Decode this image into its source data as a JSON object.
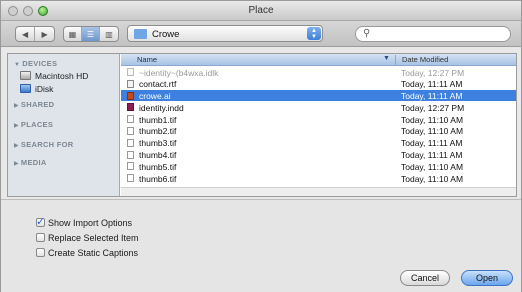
{
  "window": {
    "title": "Place"
  },
  "toolbar": {
    "path": "Crowe",
    "search_placeholder": ""
  },
  "sidebar": {
    "sections": [
      {
        "label": "DEVICES",
        "expanded": true,
        "items": [
          {
            "label": "Macintosh HD",
            "icon": "hard-drive-icon"
          },
          {
            "label": "iDisk",
            "icon": "idisk-icon"
          }
        ]
      },
      {
        "label": "SHARED",
        "expanded": false,
        "items": []
      },
      {
        "label": "PLACES",
        "expanded": false,
        "items": []
      },
      {
        "label": "SEARCH FOR",
        "expanded": false,
        "items": []
      },
      {
        "label": "MEDIA",
        "expanded": false,
        "items": []
      }
    ]
  },
  "list": {
    "columns": {
      "name": "Name",
      "date": "Date Modified"
    },
    "rows": [
      {
        "name": "~identity~(b4wxa.idlk",
        "date": "Today, 12:27 PM",
        "type": "idlk",
        "dimmed": true,
        "selected": false
      },
      {
        "name": "contact.rtf",
        "date": "Today, 11:11 AM",
        "type": "rtf",
        "dimmed": false,
        "selected": false
      },
      {
        "name": "crowe.ai",
        "date": "Today, 11:11 AM",
        "type": "ai",
        "dimmed": false,
        "selected": true
      },
      {
        "name": "identity.indd",
        "date": "Today, 12:27 PM",
        "type": "indd",
        "dimmed": false,
        "selected": false
      },
      {
        "name": "thumb1.tif",
        "date": "Today, 11:10 AM",
        "type": "tif",
        "dimmed": false,
        "selected": false
      },
      {
        "name": "thumb2.tif",
        "date": "Today, 11:10 AM",
        "type": "tif",
        "dimmed": false,
        "selected": false
      },
      {
        "name": "thumb3.tif",
        "date": "Today, 11:11 AM",
        "type": "tif",
        "dimmed": false,
        "selected": false
      },
      {
        "name": "thumb4.tif",
        "date": "Today, 11:11 AM",
        "type": "tif",
        "dimmed": false,
        "selected": false
      },
      {
        "name": "thumb5.tif",
        "date": "Today, 11:10 AM",
        "type": "tif",
        "dimmed": false,
        "selected": false
      },
      {
        "name": "thumb6.tif",
        "date": "Today, 11:10 AM",
        "type": "tif",
        "dimmed": false,
        "selected": false
      }
    ]
  },
  "options": {
    "show_import_options": {
      "label": "Show Import Options",
      "checked": true
    },
    "replace_selected_item": {
      "label": "Replace Selected Item",
      "checked": false
    },
    "create_static_captions": {
      "label": "Create Static Captions",
      "checked": false
    }
  },
  "buttons": {
    "cancel": "Cancel",
    "open": "Open"
  },
  "colors": {
    "selection": "#3d80df",
    "sidebar_bg": "#dfe4ea",
    "default_button": "#6aa6ee"
  }
}
